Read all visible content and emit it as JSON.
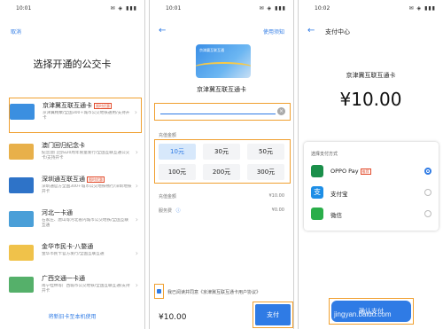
{
  "panel1": {
    "status_time": "10:01",
    "status_icons": "✉ ◈ ▮▮▮",
    "cancel_label": "取消",
    "title": "选择开通的公交卡",
    "cards": [
      {
        "name": "京津冀互联互通卡",
        "tag": "限时优惠",
        "desc": "京津冀畅乘/全国300+城市公交地铁通用/支持开卡",
        "color": "#3b8fe0"
      },
      {
        "name": "澳门回归纪念卡",
        "tag": "",
        "desc": "纪念澳门回归20周年限量发行/全国互联互通公交卡/支持开卡",
        "color": "#e8b04a"
      },
      {
        "name": "深圳通互联互通",
        "tag": "限时优惠",
        "desc": "深圳通官方全国300+城市公交地铁畅行/深圳地铁开卡",
        "color": "#2e73c8"
      },
      {
        "name": "河北一卡通",
        "tag": "",
        "desc": "石家庄、唐山等河北省内城市公交地铁/全国互联互通",
        "color": "#4a9fd8"
      },
      {
        "name": "金华市民卡·八婺通",
        "tag": "",
        "desc": "金华市民卡官方发行/全国互联互通",
        "color": "#f0c24a"
      },
      {
        "name": "广西交通一卡通",
        "tag": "",
        "desc": "南宁桂林等广西城市公交地铁/全国互联互通/支持开卡",
        "color": "#55b06a"
      }
    ],
    "footer_link": "将新旧卡至本机使用"
  },
  "panel2": {
    "status_time": "10:01",
    "status_icons": "✉ ◈ ▮▮▮",
    "back_icon": "←",
    "help_label": "使用须知",
    "card_logo_text": "京津冀互联互通",
    "card_name": "京津冀互联互通卡",
    "clear_icon": "×",
    "amount_label": "充值金额",
    "amounts": [
      "10元",
      "30元",
      "50元",
      "100元",
      "200元",
      "300元"
    ],
    "selected_amount_index": 0,
    "rows": [
      {
        "label": "充值金额",
        "value": "¥10.00"
      },
      {
        "label": "服务费",
        "value": "¥0.00"
      }
    ],
    "agree_text": "我已阅读并同意《京津冀互联互通卡用户协议》",
    "price": "¥10.00",
    "pay_label": "支付"
  },
  "panel3": {
    "status_time": "10:02",
    "status_icons": "✉ ◈ ▮▮▮",
    "back_icon": "←",
    "header": "支付中心",
    "card_name": "京津冀互联互通卡",
    "amount": "¥10.00",
    "method_title": "选择支付方式",
    "methods": [
      {
        "label": "OPPO Pay",
        "tag": "推荐",
        "color": "#1a8f4a",
        "selected": true
      },
      {
        "label": "支付宝",
        "tag": "",
        "color": "#1d8ee6",
        "selected": false
      },
      {
        "label": "微信",
        "tag": "",
        "color": "#2aae4a",
        "selected": false
      }
    ],
    "confirm_label": "确认支付",
    "watermark": "jingyan.baidu.com"
  },
  "colors": {
    "accent": "#2f7be5",
    "highlight": "#f0a030"
  }
}
